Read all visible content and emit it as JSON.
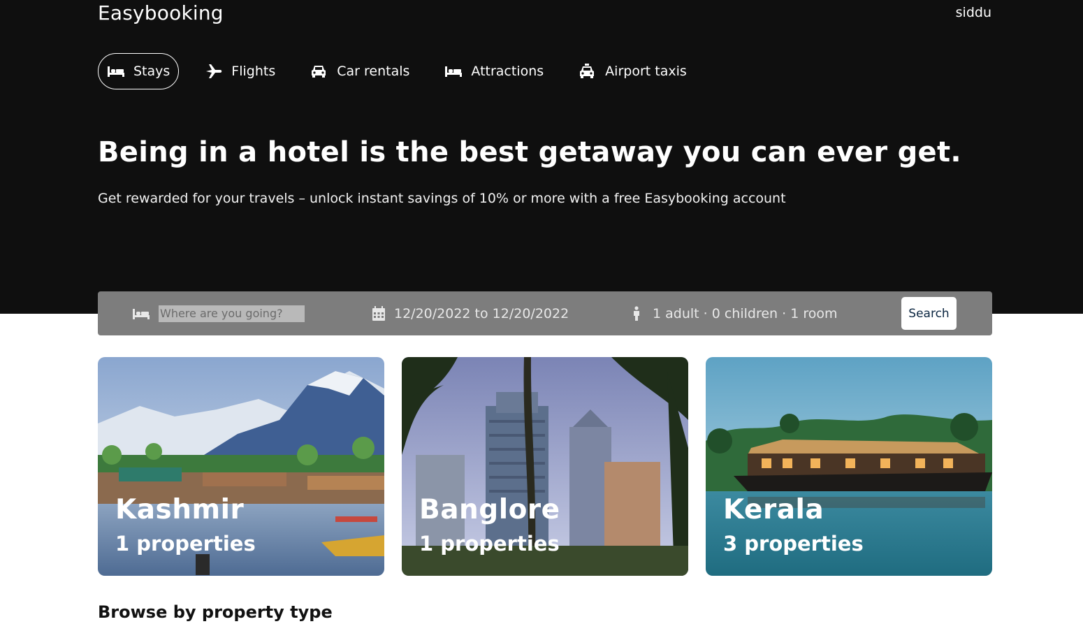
{
  "header": {
    "brand": "Easybooking",
    "user": "siddu",
    "nav": [
      {
        "label": "Stays",
        "icon": "bed-icon",
        "active": true
      },
      {
        "label": "Flights",
        "icon": "plane-icon"
      },
      {
        "label": "Car rentals",
        "icon": "car-icon"
      },
      {
        "label": "Attractions",
        "icon": "bed-icon"
      },
      {
        "label": "Airport taxis",
        "icon": "taxi-icon"
      }
    ],
    "title": "Being in a hotel is the best getaway you can ever get.",
    "subtitle": "Get rewarded for your travels – unlock instant savings of 10% or more with a free Easybooking account"
  },
  "search": {
    "destination_placeholder": "Where are you going?",
    "dates": "12/20/2022 to 12/20/2022",
    "options": "1 adult · 0 children · 1 room",
    "button": "Search"
  },
  "featured": [
    {
      "city": "Kashmir",
      "count": "1 properties"
    },
    {
      "city": "Banglore",
      "count": "1 properties"
    },
    {
      "city": "Kerala",
      "count": "3 properties"
    }
  ],
  "section_title": "Browse by property type",
  "colors": {
    "header_bg": "#0f0f0f",
    "search_bg": "#7d7d7d"
  }
}
